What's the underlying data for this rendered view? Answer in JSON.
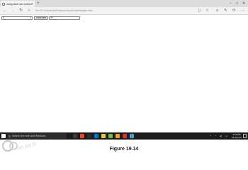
{
  "browser": {
    "tab_title": "using label and button ele",
    "address": "file:///C:/Users/Hp/Desktop/JavaScript/sample.html",
    "nav_icons": [
      "back-icon",
      "forward-icon",
      "refresh-icon",
      "home-icon"
    ],
    "toolbar_icons": [
      "reading-view-icon",
      "favorite-star-icon",
      "hub-icon",
      "note-icon",
      "share-icon",
      "more-icon"
    ]
  },
  "page": {
    "select_value": "5",
    "button_label": "calculate",
    "output_value": "50"
  },
  "taskbar": {
    "search_placeholder": "Search the web and Windows",
    "time": "3:54 PM",
    "date": "26-Jun-15",
    "app_colors": [
      "#3a3a3a",
      "#e8481c",
      "#2b2b2b",
      "#0078d7",
      "#f2c12e",
      "#6fbf3a",
      "#e2a32b",
      "#d9312b",
      "#5a9bd5"
    ]
  },
  "caption": "Figure 19.14",
  "watermark": "on All R"
}
